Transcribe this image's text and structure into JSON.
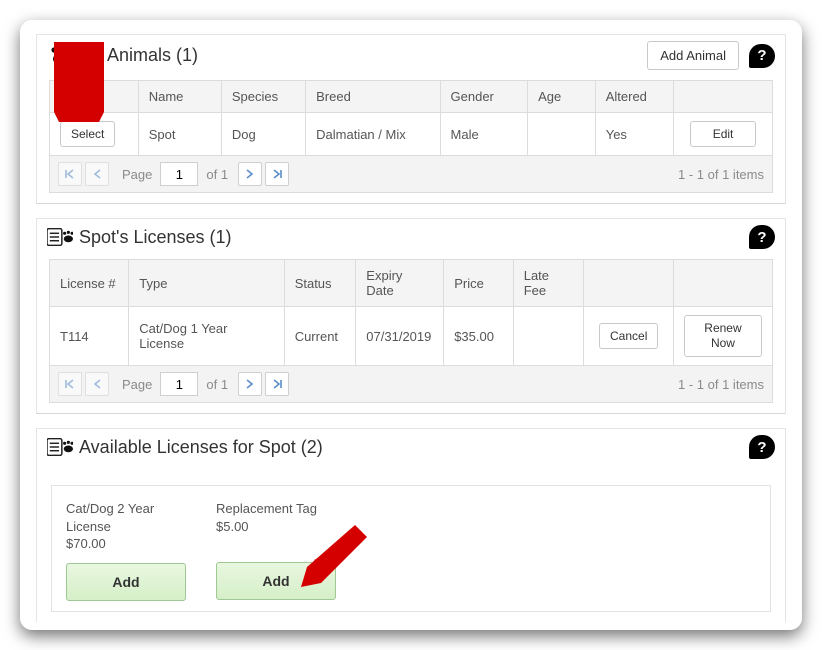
{
  "animals": {
    "title": "My Animals (1)",
    "addLabel": "Add Animal",
    "columns": [
      "",
      "Name",
      "Species",
      "Breed",
      "Gender",
      "Age",
      "Altered",
      ""
    ],
    "row": {
      "select": "Select",
      "name": "Spot",
      "species": "Dog",
      "breed": "Dalmatian / Mix",
      "gender": "Male",
      "age": "",
      "altered": "Yes",
      "edit": "Edit"
    },
    "pager": {
      "pageLabel": "Page",
      "pageValue": "1",
      "of": "of 1",
      "info": "1 - 1 of 1 items"
    }
  },
  "licenses": {
    "title": "Spot's Licenses (1)",
    "columns": [
      "License #",
      "Type",
      "Status",
      "Expiry Date",
      "Price",
      "Late Fee",
      "",
      ""
    ],
    "row": {
      "num": "T114",
      "type": "Cat/Dog 1 Year License",
      "status": "Current",
      "expiry": "07/31/2019",
      "price": "$35.00",
      "late": "",
      "cancel": "Cancel",
      "renew": "Renew Now"
    },
    "pager": {
      "pageLabel": "Page",
      "pageValue": "1",
      "of": "of 1",
      "info": "1 - 1 of 1 items"
    }
  },
  "available": {
    "title": "Available Licenses for Spot (2)",
    "cards": [
      {
        "label": "Cat/Dog 2 Year License",
        "price": "$70.00",
        "add": "Add"
      },
      {
        "label": "Replacement Tag",
        "price": "$5.00",
        "add": "Add"
      }
    ]
  },
  "help": "?"
}
